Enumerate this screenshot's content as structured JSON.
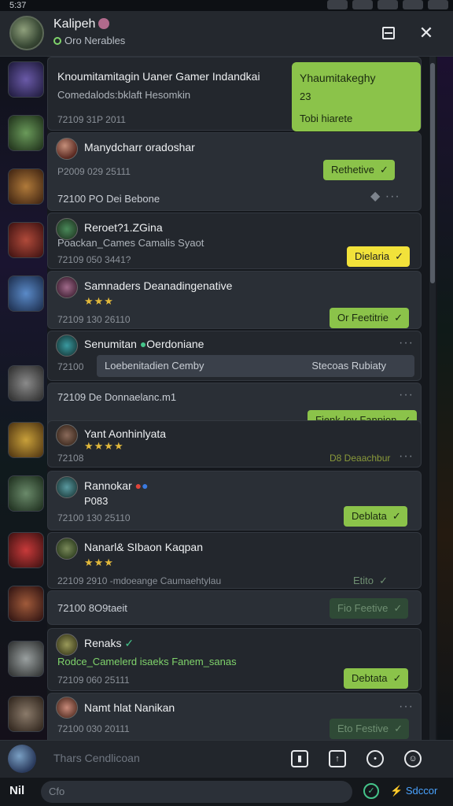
{
  "status_bar": {
    "time": "5:37"
  },
  "header": {
    "title": "Kalipeh",
    "subtitle": "Oro Nerables",
    "menu_icon": "menu-box-icon",
    "close_icon": "close-icon"
  },
  "messages": [
    {
      "title": "Knoumitamitagin Uaner Gamer Indandkai",
      "subtitle": "Comedalods:bklaft Hesomkin",
      "meta": "72109    31P  2011",
      "bubble": {
        "t1": "Yhaumitakeghy",
        "t2": "23",
        "t3": "Tobi  hiarete"
      }
    },
    {
      "name": "Manydcharr oradoshar",
      "meta": "P2009    029  25111",
      "pill": "Rethetive",
      "row2": "72100   PO Dei Bebone"
    },
    {
      "name": "Reroet?1.ZGina",
      "line": "Poackan_Cames Camalis Syaot",
      "meta": "72109    050  3441?",
      "pill": "Dielaria"
    },
    {
      "name": "Samnaders Deanadingenative",
      "stars": "★★★",
      "meta": "72109    130  26110",
      "pill": "Or Feetitrie"
    },
    {
      "name": "Senumitan",
      "name_suffix": "Oerdoniane",
      "meta": "72100",
      "chip_left": "Loebenitadien Cemby",
      "chip_right": "Stecoas Rubiaty"
    },
    {
      "row": "72109   De Donnaelanc.m1",
      "pill": "Fienk  Iov Fanpion"
    },
    {
      "name": "Yant Aonhinlyata",
      "stars": "★★★★",
      "meta": "72108",
      "meta_right": "D8  Deaachbur"
    },
    {
      "name": "Rannokar",
      "line": "P083",
      "meta": "72100    130  25110",
      "pill": "Deblata"
    },
    {
      "name": "Nanarl&  SIbaon Kaqpan",
      "stars": "★★★",
      "meta": "22109    2910 -mdoeange Caumaehtylau",
      "pill_dim": "Etito"
    },
    {
      "row": "72100   8O9taeit",
      "pill_dim": "Fio  Feetive"
    },
    {
      "name": "Renaks",
      "line": "Rodce_Camelerd isaeks Fanem_sanas",
      "meta": "72109    060  25111",
      "pill": "Debtata"
    },
    {
      "name": "Namt hlat Nanikan",
      "meta": "72100    030  20111",
      "pill_dim": "Eto  Festive"
    }
  ],
  "composer": {
    "placeholder": "Thars Cendlicoan"
  },
  "footer": {
    "logo": "Nil",
    "field": "Cfo",
    "send_label": "Sdccor"
  }
}
